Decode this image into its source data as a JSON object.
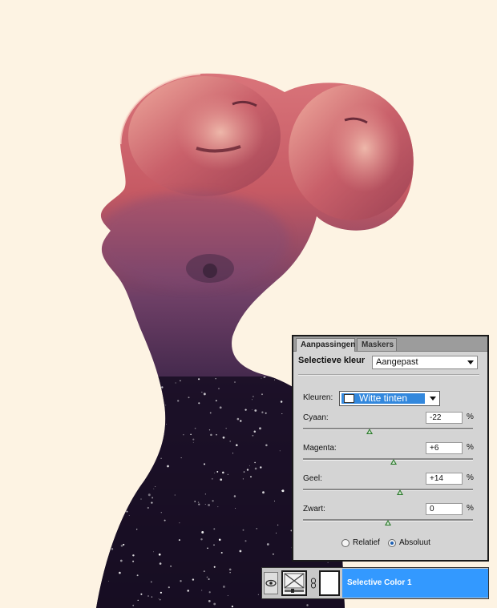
{
  "panel": {
    "tabs": [
      {
        "label": "Aanpassingen",
        "active": true
      },
      {
        "label": "Maskers",
        "active": false
      }
    ],
    "title": "Selectieve kleur",
    "preset": "Aangepast",
    "colors_label": "Kleuren:",
    "colors_value": "Witte tinten",
    "sliders": [
      {
        "label": "Cyaan:",
        "value": "-22",
        "unit": "%"
      },
      {
        "label": "Magenta:",
        "value": "+6",
        "unit": "%"
      },
      {
        "label": "Geel:",
        "value": "+14",
        "unit": "%"
      },
      {
        "label": "Zwart:",
        "value": "0",
        "unit": "%"
      }
    ],
    "method_relative": "Relatief",
    "method_absolute": "Absoluut",
    "selected_method": "absolute"
  },
  "layer": {
    "name": "Selective Color 1"
  },
  "colors": {
    "background": "#fdf3e3",
    "panel": "#d4d4d4",
    "selection": "#3399ff",
    "slider_thumb": "#2d7a2d"
  },
  "icons": [
    "eye-icon",
    "chain-link-icon",
    "adjustment-thumbnail-icon",
    "dropdown-arrow-icon"
  ]
}
